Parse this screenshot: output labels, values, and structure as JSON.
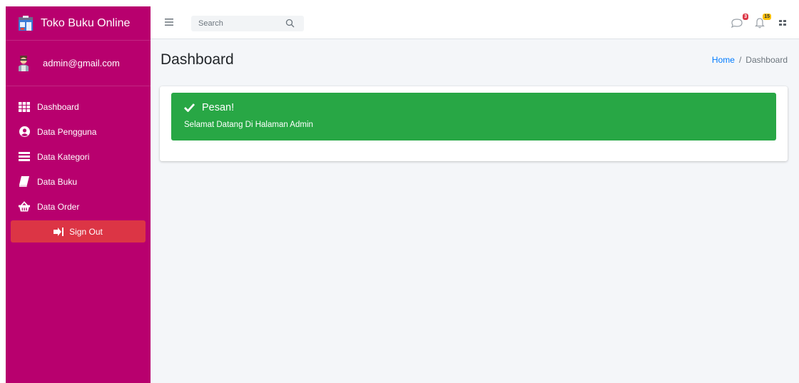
{
  "app": {
    "brand_title": "Toko Buku Online"
  },
  "user": {
    "name": "admin@gmail.com"
  },
  "sidebar": {
    "items": [
      {
        "label": "Dashboard",
        "icon": "grid-icon"
      },
      {
        "label": "Data Pengguna",
        "icon": "user-circle-icon"
      },
      {
        "label": "Data Kategori",
        "icon": "list-icon"
      },
      {
        "label": "Data Buku",
        "icon": "book-icon"
      },
      {
        "label": "Data Order",
        "icon": "basket-icon"
      }
    ],
    "signout_label": "Sign Out"
  },
  "topbar": {
    "search_placeholder": "Search",
    "messages_count": "3",
    "notifications_count": "15"
  },
  "content": {
    "page_title": "Dashboard",
    "breadcrumb": {
      "home": "Home",
      "separator": "/",
      "current": "Dashboard"
    }
  },
  "alert": {
    "title": "Pesan!",
    "message": "Selamat Datang Di Halaman Admin"
  },
  "colors": {
    "sidebar_bg": "#b8006e",
    "signout_bg": "#dc3545",
    "alert_bg": "#28a745",
    "link": "#007bff"
  }
}
